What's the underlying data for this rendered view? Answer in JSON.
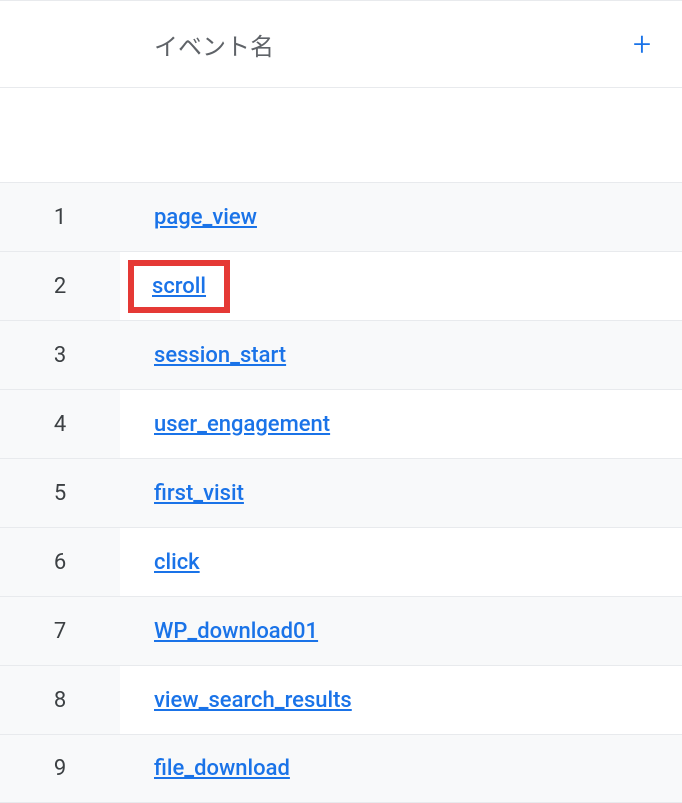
{
  "header": {
    "label": "イベント名",
    "plus_icon": "+"
  },
  "rows": [
    {
      "num": "1",
      "event": "page_view",
      "striped": true,
      "highlighted": false
    },
    {
      "num": "2",
      "event": "scroll",
      "striped": false,
      "highlighted": true
    },
    {
      "num": "3",
      "event": "session_start",
      "striped": true,
      "highlighted": false
    },
    {
      "num": "4",
      "event": "user_engagement",
      "striped": false,
      "highlighted": false
    },
    {
      "num": "5",
      "event": "first_visit",
      "striped": true,
      "highlighted": false
    },
    {
      "num": "6",
      "event": "click",
      "striped": false,
      "highlighted": false
    },
    {
      "num": "7",
      "event": "WP_download01",
      "striped": true,
      "highlighted": false
    },
    {
      "num": "8",
      "event": "view_search_results",
      "striped": false,
      "highlighted": false
    },
    {
      "num": "9",
      "event": "file_download",
      "striped": true,
      "highlighted": false
    }
  ]
}
